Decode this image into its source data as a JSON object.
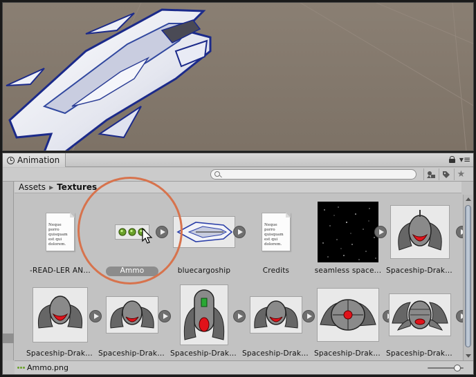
{
  "panel": {
    "tab_label": "Animation",
    "search_placeholder": "",
    "breadcrumb": [
      "Assets",
      "Textures"
    ]
  },
  "assets": [
    {
      "label": "-READ-LER AN...",
      "type": "document",
      "doc_text": "Neque porro quisquam est qui dolorem.",
      "has_play": false
    },
    {
      "label": "Ammo",
      "type": "ammo",
      "selected": true,
      "has_play": true
    },
    {
      "label": "bluecargoship",
      "type": "ship",
      "has_play": true
    },
    {
      "label": "Credits",
      "type": "document",
      "doc_text": "Neque porro quisquam est qui dolorem.",
      "has_play": false
    },
    {
      "label": "seamless space...",
      "type": "space",
      "has_play": true
    },
    {
      "label": "Spaceship-Draki...",
      "type": "drakir",
      "has_play": true
    },
    {
      "label": "Spaceship-Draki...",
      "type": "drakir",
      "has_play": true
    },
    {
      "label": "Spaceship-Draki...",
      "type": "drakir",
      "has_play": true
    },
    {
      "label": "Spaceship-Draki...",
      "type": "drakir-green",
      "has_play": true
    },
    {
      "label": "Spaceship-Draki...",
      "type": "drakir",
      "has_play": true
    },
    {
      "label": "Spaceship-Draki...",
      "type": "drakir-round",
      "has_play": true
    },
    {
      "label": "Spaceship-Draki...",
      "type": "drakir-wide",
      "has_play": true
    }
  ],
  "status": {
    "selected_file": "Ammo.png",
    "zoom_level": 0.9
  },
  "colors": {
    "highlight": "#d7734d",
    "ammo_green": "#6aa12a",
    "ship_blue": "#2b3fa8",
    "drakir_red": "#e0121a"
  }
}
